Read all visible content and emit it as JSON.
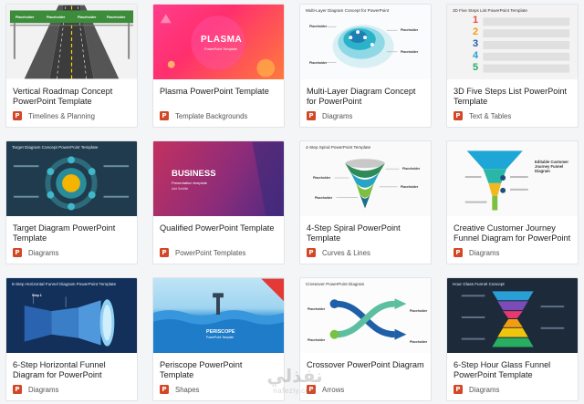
{
  "cards": [
    {
      "title": "Vertical Roadmap Concept PowerPoint Template",
      "category": "Timelines & Planning",
      "thumb_texts": [
        "Placeholder",
        "Placeholder",
        "Placeholder",
        "Placeholder"
      ]
    },
    {
      "title": "Plasma PowerPoint Template",
      "category": "Template Backgrounds",
      "thumb_texts": [
        "PLASMA",
        "PowerPoint Template"
      ]
    },
    {
      "title": "Multi-Layer Diagram Concept for PowerPoint",
      "category": "Diagrams",
      "thumb_texts": [
        "Multi-Layer Diagram Concept for PowerPoint",
        "Placeholder",
        "Placeholder",
        "Placeholder",
        "Placeholder"
      ]
    },
    {
      "title": "3D Five Steps List PowerPoint Template",
      "category": "Text & Tables",
      "thumb_texts": [
        "3D Five Steps List PowerPoint Template",
        "1",
        "2",
        "3",
        "4",
        "5"
      ]
    },
    {
      "title": "Target Diagram PowerPoint Template",
      "category": "Diagrams",
      "thumb_texts": [
        "Target Diagram Concept PowerPoint Template"
      ]
    },
    {
      "title": "Qualified PowerPoint Template",
      "category": "PowerPoint Templates",
      "thumb_texts": [
        "BUSINESS",
        "Presentation template",
        "Add Subtitle"
      ]
    },
    {
      "title": "4-Step Spiral PowerPoint Template",
      "category": "Curves & Lines",
      "thumb_texts": [
        "4-Step Spiral PowerPoint Template",
        "Placeholder",
        "Placeholder",
        "Placeholder",
        "Placeholder"
      ]
    },
    {
      "title": "Creative Customer Journey Funnel Diagram for PowerPoint",
      "category": "Diagrams",
      "thumb_texts": [
        "Editable Customer Journey Funnel Diagram"
      ]
    },
    {
      "title": "6-Step Horizontal Funnel Diagram for PowerPoint",
      "category": "Diagrams",
      "thumb_texts": [
        "6-Step Horizontal Funnel Diagram PowerPoint Template",
        "Step 1"
      ]
    },
    {
      "title": "Periscope PowerPoint Template",
      "category": "Shapes",
      "thumb_texts": [
        "PERISCOPE",
        "PowerPoint Template"
      ]
    },
    {
      "title": "Crossover PowerPoint Diagram",
      "category": "Arrows",
      "thumb_texts": [
        "Crossover PowerPoint Diagram",
        "Placeholder",
        "Placeholder",
        "Placeholder",
        "Placeholder"
      ]
    },
    {
      "title": "6-Step Hour Glass Funnel PowerPoint Template",
      "category": "Diagrams",
      "thumb_texts": [
        "Hour Glass Funnel Concept"
      ]
    }
  ],
  "file_icon": {
    "glyph": "P",
    "color": "#d24726"
  },
  "watermark": {
    "arabic": "نفذلي",
    "latin": "nafezly.com"
  }
}
